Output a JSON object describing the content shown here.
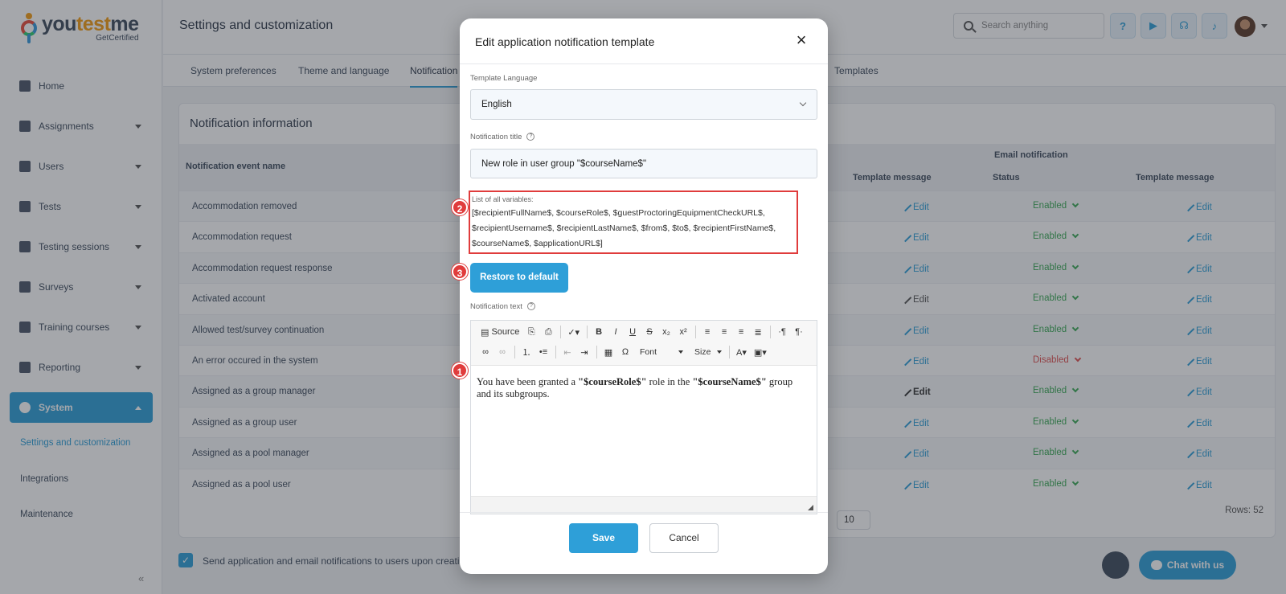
{
  "brand": {
    "name_part1": "you",
    "name_part2": "test",
    "name_part3": "me",
    "tagline": "GetCertified"
  },
  "sidebar": {
    "items": [
      {
        "label": "Home",
        "icon": "home-icon"
      },
      {
        "label": "Assignments",
        "icon": "assignments-icon"
      },
      {
        "label": "Users",
        "icon": "users-icon"
      },
      {
        "label": "Tests",
        "icon": "tests-icon"
      },
      {
        "label": "Testing sessions",
        "icon": "calendar-icon"
      },
      {
        "label": "Surveys",
        "icon": "surveys-icon"
      },
      {
        "label": "Training courses",
        "icon": "trophy-icon"
      },
      {
        "label": "Reporting",
        "icon": "reporting-icon"
      },
      {
        "label": "System",
        "icon": "gear-icon"
      }
    ],
    "sub_items": [
      "Settings and customization",
      "Integrations",
      "Maintenance"
    ]
  },
  "header": {
    "title": "Settings and customization",
    "search_placeholder": "Search anything"
  },
  "tabs": [
    "System preferences",
    "Theme and language",
    "Notification",
    "Templates"
  ],
  "card": {
    "title": "Notification information",
    "col_event": "Notification event name",
    "col_email_group": "Email notification",
    "col_template1": "Template message",
    "col_status": "Status",
    "col_template2": "Template message",
    "rows": [
      {
        "name": "Accommodation removed",
        "status": "Enabled"
      },
      {
        "name": "Accommodation request",
        "status": "Enabled"
      },
      {
        "name": "Accommodation request response",
        "status": "Enabled"
      },
      {
        "name": "Activated account",
        "status": "Enabled"
      },
      {
        "name": "Allowed test/survey continuation",
        "status": "Enabled"
      },
      {
        "name": "An error occured in the system",
        "status": "Disabled"
      },
      {
        "name": "Assigned as a group manager",
        "status": "Enabled"
      },
      {
        "name": "Assigned as a group user",
        "status": "Enabled"
      },
      {
        "name": "Assigned as a pool manager",
        "status": "Enabled"
      },
      {
        "name": "Assigned as a pool user",
        "status": "Enabled"
      }
    ],
    "edit_label": "Edit",
    "page_size": "10",
    "rows_count": "Rows: 52"
  },
  "footer": {
    "send_notifications": "Send application and email notifications to users upon creation o",
    "chat_label": "Chat with us"
  },
  "modal": {
    "title": "Edit application notification template",
    "template_language_label": "Template Language",
    "template_language_value": "English",
    "notification_title_label": "Notification title",
    "notification_title_value": "New role in user group \"$courseName$\"",
    "variables_label": "List of all variables:",
    "variables_text": "[$recipientFullName$, $courseRole$, $guestProctoringEquipmentCheckURL$, $recipientUsername$, $recipientLastName$, $from$, $to$, $recipientFirstName$, $courseName$, $applicationURL$]",
    "restore_label": "Restore to default",
    "notification_text_label": "Notification text",
    "editor": {
      "source_label": "Source",
      "font_label": "Font",
      "size_label": "Size",
      "body_part1": "You have been granted a ",
      "body_bold1": "\"$courseRole$\"",
      "body_part2": " role in the ",
      "body_bold2": "\"$courseName$\"",
      "body_part3": " group and its subgroups."
    },
    "save_label": "Save",
    "cancel_label": "Cancel",
    "markers": [
      "1",
      "2",
      "3"
    ]
  },
  "colors": {
    "accent": "#2e9fd8",
    "marker": "#e03c3c",
    "enabled": "#3aaa55",
    "disabled": "#e05050"
  }
}
